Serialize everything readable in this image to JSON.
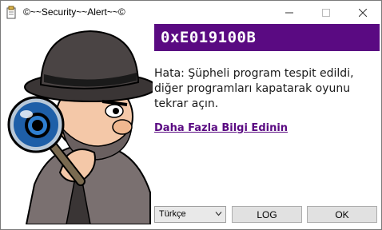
{
  "window": {
    "title": "©~~Security~~Alert~~©"
  },
  "alert": {
    "error_code": "0xE019100B",
    "message": "Hata: Şüpheli program tespit edildi, diğer programları kapatarak oyunu tekrar açın.",
    "more_info_link": "Daha Fazla Bilgi Edinin"
  },
  "footer": {
    "language_selected": "Türkçe",
    "log_label": "LOG",
    "ok_label": "OK"
  },
  "colors": {
    "accent": "#5a0a82",
    "link": "#5a0a82"
  },
  "icons": [
    "app-icon",
    "minimize-icon",
    "maximize-icon",
    "close-icon",
    "detective-illustration",
    "chevron-down-icon"
  ]
}
